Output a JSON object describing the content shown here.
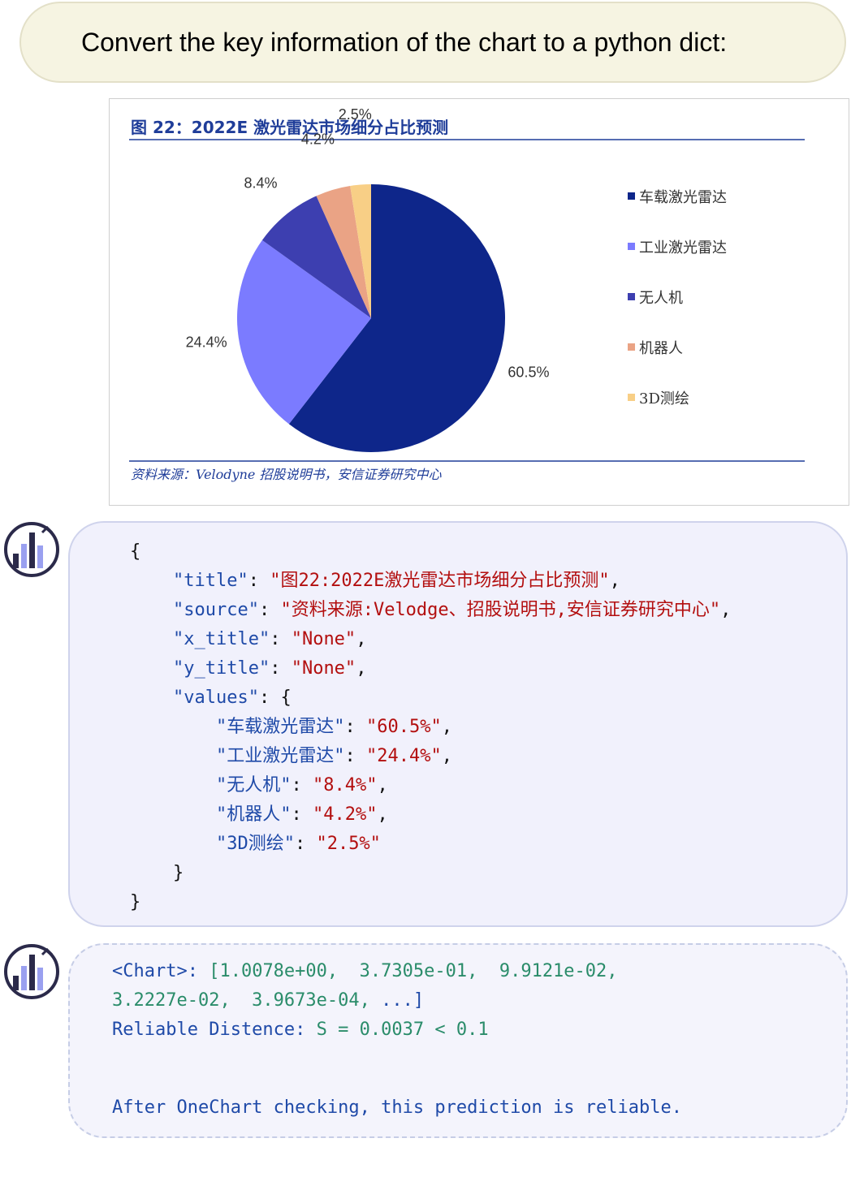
{
  "prompt": {
    "text": "Convert the key information of the chart to a python dict:"
  },
  "chart_data": {
    "type": "pie",
    "title": "图 22：2022E 激光雷达市场细分占比预测",
    "source": "资料来源：Velodyne 招股说明书，安信证券研究中心",
    "categories": [
      "车载激光雷达",
      "工业激光雷达",
      "无人机",
      "机器人",
      "3D测绘"
    ],
    "values": [
      60.5,
      24.4,
      8.4,
      4.2,
      2.5
    ],
    "labels": [
      "60.5%",
      "24.4%",
      "8.4%",
      "4.2%",
      "2.5%"
    ],
    "colors": [
      "#0e268a",
      "#7b7bff",
      "#3d3fb0",
      "#eaa385",
      "#f8cf86"
    ],
    "legend": "right"
  },
  "answer": {
    "open_brace": "{",
    "close_brace": "}",
    "inner_close": "}",
    "title_key": "\"title\"",
    "title_val": "\"图22:2022E激光雷达市场细分占比预测\"",
    "source_key": "\"source\"",
    "source_val": "\"资料来源:Velodge、招股说明书,安信证券研究中心\"",
    "x_title_key": "\"x_title\"",
    "x_title_val": "\"None\"",
    "y_title_key": "\"y_title\"",
    "y_title_val": "\"None\"",
    "values_key": "\"values\"",
    "values_open": "{",
    "items": [
      {
        "key": "\"车载激光雷达\"",
        "val": "\"60.5%\"",
        "sep": ","
      },
      {
        "key": "\"工业激光雷达\"",
        "val": "\"24.4%\"",
        "sep": ","
      },
      {
        "key": "\"无人机\"",
        "val": "\"8.4%\"",
        "sep": ","
      },
      {
        "key": "\"机器人\"",
        "val": "\"4.2%\"",
        "sep": ","
      },
      {
        "key": "\"3D测绘\"",
        "val": "\"2.5%\"",
        "sep": ""
      }
    ]
  },
  "check": {
    "chart_tag": "<Chart>:",
    "vector_line1": " [1.0078e+00,  3.7305e-01,  9.9121e-02,",
    "vector_line2": "3.2227e-02,  3.9673e-04,",
    "ellipsis": " ...]",
    "distance_label": "Reliable Distence: ",
    "distance_value": "S = 0.0037 < 0.1",
    "verdict": "After OneChart checking, this prediction is reliable."
  },
  "colors": {
    "avatar_dark": "#2b2a4a",
    "avatar_light": "#9aa0f0"
  }
}
